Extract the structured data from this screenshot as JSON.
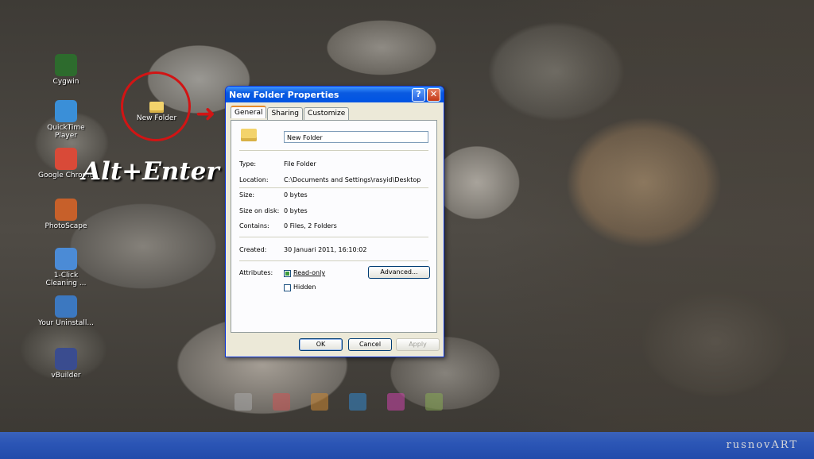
{
  "desktop": {
    "icons": [
      {
        "label": "Cygwin",
        "icon": "cygwin-icon",
        "color": "#2d6b2d"
      },
      {
        "label": "QuickTime Player",
        "icon": "quicktime-icon",
        "color": "#3a8fd8"
      },
      {
        "label": "Google Chrome",
        "icon": "chrome-icon",
        "color": "#d94a38"
      },
      {
        "label": "PhotoScape",
        "icon": "photoscape-icon",
        "color": "#c7602a"
      },
      {
        "label": "1-Click Cleaning ...",
        "icon": "cleaning-icon",
        "color": "#4b8bd6"
      },
      {
        "label": "Your Uninstall...",
        "icon": "uninstaller-icon",
        "color": "#3c78c0"
      },
      {
        "label": "vBuilder",
        "icon": "builder-icon",
        "color": "#3a4c8f"
      }
    ],
    "new_folder_label": "New Folder",
    "shortcut_text": "Alt+Enter",
    "watermark": "rusnovART"
  },
  "dialog": {
    "title": "New Folder Properties",
    "tabs": [
      "General",
      "Sharing",
      "Customize"
    ],
    "active_tab": "General",
    "name_value": "New Folder",
    "fields": {
      "type_label": "Type:",
      "type_value": "File Folder",
      "location_label": "Location:",
      "location_value": "C:\\Documents and Settings\\rasyid\\Desktop",
      "size_label": "Size:",
      "size_value": "0 bytes",
      "size_on_disk_label": "Size on disk:",
      "size_on_disk_value": "0 bytes",
      "contains_label": "Contains:",
      "contains_value": "0 Files, 2 Folders",
      "created_label": "Created:",
      "created_value": "30 Januari 2011, 16:10:02",
      "attributes_label": "Attributes:"
    },
    "read_only_label": "Read-only",
    "hidden_label": "Hidden",
    "advanced_label": "Advanced...",
    "ok_label": "OK",
    "cancel_label": "Cancel",
    "apply_label": "Apply",
    "colors": {
      "title_bar": "#0054e3",
      "accent_red": "#d21414"
    }
  }
}
